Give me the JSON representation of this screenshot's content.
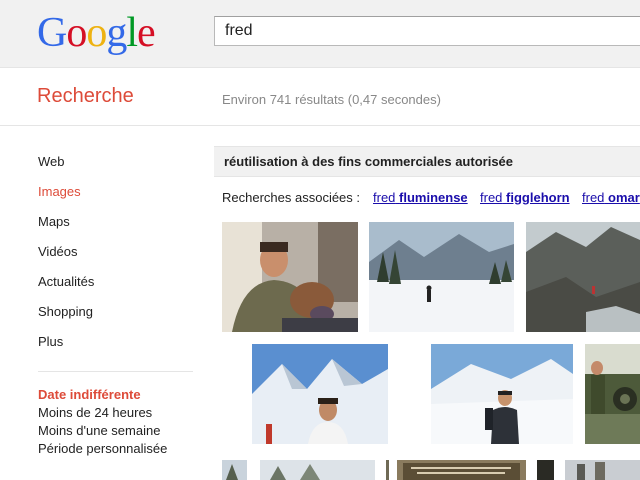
{
  "header": {
    "logo_letters": [
      "G",
      "o",
      "o",
      "g",
      "l",
      "e"
    ],
    "search_query": "fred"
  },
  "results_header": {
    "section_title": "Recherche",
    "stats": "Environ 741 résultats (0,47 secondes)"
  },
  "sidebar": {
    "items": [
      {
        "label": "Web",
        "active": false
      },
      {
        "label": "Images",
        "active": true
      },
      {
        "label": "Maps",
        "active": false
      },
      {
        "label": "Vidéos",
        "active": false
      },
      {
        "label": "Actualités",
        "active": false
      },
      {
        "label": "Shopping",
        "active": false
      },
      {
        "label": "Plus",
        "active": false
      }
    ],
    "time_filters": [
      {
        "label": "Date indifférente",
        "active": true
      },
      {
        "label": "Moins de 24 heures",
        "active": false
      },
      {
        "label": "Moins d'une semaine",
        "active": false
      },
      {
        "label": "Période personnalisée",
        "active": false
      }
    ]
  },
  "main": {
    "license_filter": "réutilisation à des fins commerciales autorisée",
    "related_label": "Recherches associées :",
    "related_searches": [
      {
        "prefix": "fred",
        "bold": "fluminense"
      },
      {
        "prefix": "fred",
        "bold": "figglehorn"
      },
      {
        "prefix": "fred",
        "bold": "omar"
      }
    ],
    "images": [
      {
        "name": "man-with-baby-photo"
      },
      {
        "name": "snowy-forest-skier-photo"
      },
      {
        "name": "mountain-cliffs-photo"
      },
      {
        "name": "man-in-snowy-mountains-photo"
      },
      {
        "name": "hiker-on-snowfield-photo"
      },
      {
        "name": "soldiers-with-cannon-photo"
      },
      {
        "name": "snowy-trees-photo"
      },
      {
        "name": "snowy-landscape-photo"
      },
      {
        "name": "trees-photo"
      },
      {
        "name": "memorial-plaque-photo"
      },
      {
        "name": "dark-photo"
      },
      {
        "name": "monument-photo"
      }
    ]
  },
  "colors": {
    "accent_red": "#dd4b39",
    "link_blue": "#1a0dab",
    "header_bg": "#f1f1f1"
  }
}
